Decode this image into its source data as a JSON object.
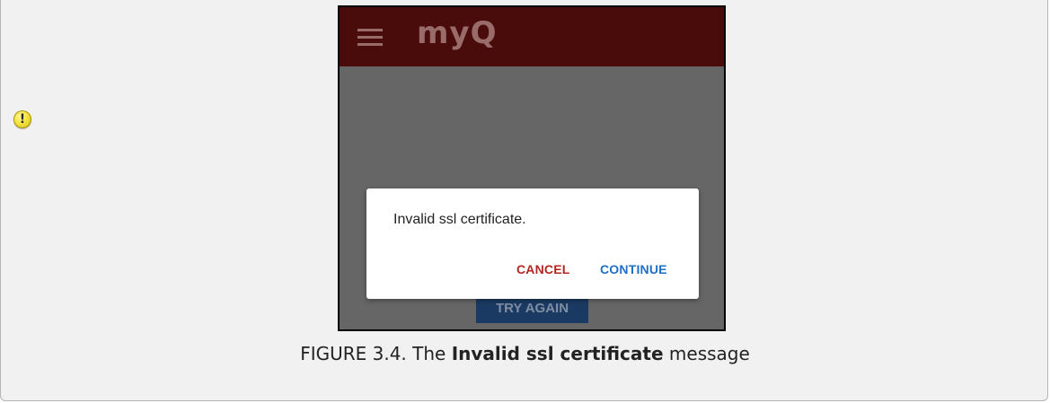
{
  "notice": {
    "icon": "warning-icon"
  },
  "app": {
    "logo_text": "myQ",
    "menu_icon": "hamburger-menu-icon",
    "colors": {
      "appbar": "#4a0b0b",
      "overlay": "#666666",
      "cancel": "#b3261e",
      "continue": "#1e6fc7"
    },
    "background_button_label": "TRY AGAIN",
    "dialog": {
      "message": "Invalid ssl certificate.",
      "cancel_label": "CANCEL",
      "continue_label": "CONTINUE"
    }
  },
  "caption": {
    "prefix": "FIGURE 3.4. The ",
    "emphasis": "Invalid ssl certificate",
    "suffix": " message"
  }
}
